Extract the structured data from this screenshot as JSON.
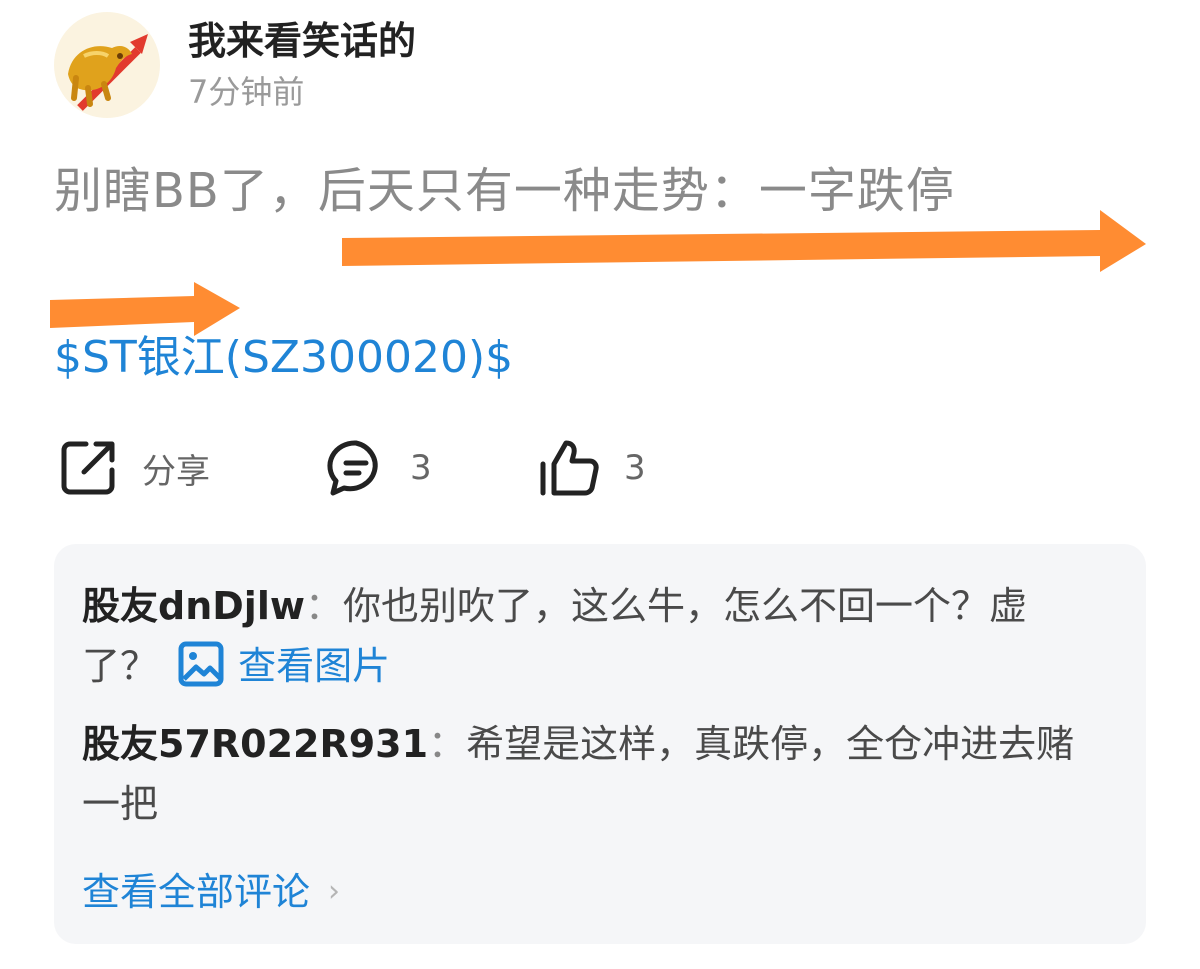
{
  "post": {
    "author": "我来看笑话的",
    "timestamp": "7分钟前",
    "text": "别瞎BB了，后天只有一种走势：一字跌停",
    "stock_link": "$ST银江(SZ300020)$"
  },
  "actions": {
    "share_label": "分享",
    "comment_count": "3",
    "like_count": "3"
  },
  "comments": [
    {
      "author": "股友dnDjlw",
      "separator": "：",
      "text": "你也别吹了，这么牛，怎么不回一个？虚了？",
      "image_link": "查看图片"
    },
    {
      "author": "股友57R022R931",
      "separator": "：",
      "text": "希望是这样，真跌停，全仓冲进去赌一把"
    }
  ],
  "view_all_label": "查看全部评论",
  "colors": {
    "link": "#1f84d6",
    "annotation_arrow": "#ff8c32",
    "comment_bg": "#f5f6f8"
  }
}
